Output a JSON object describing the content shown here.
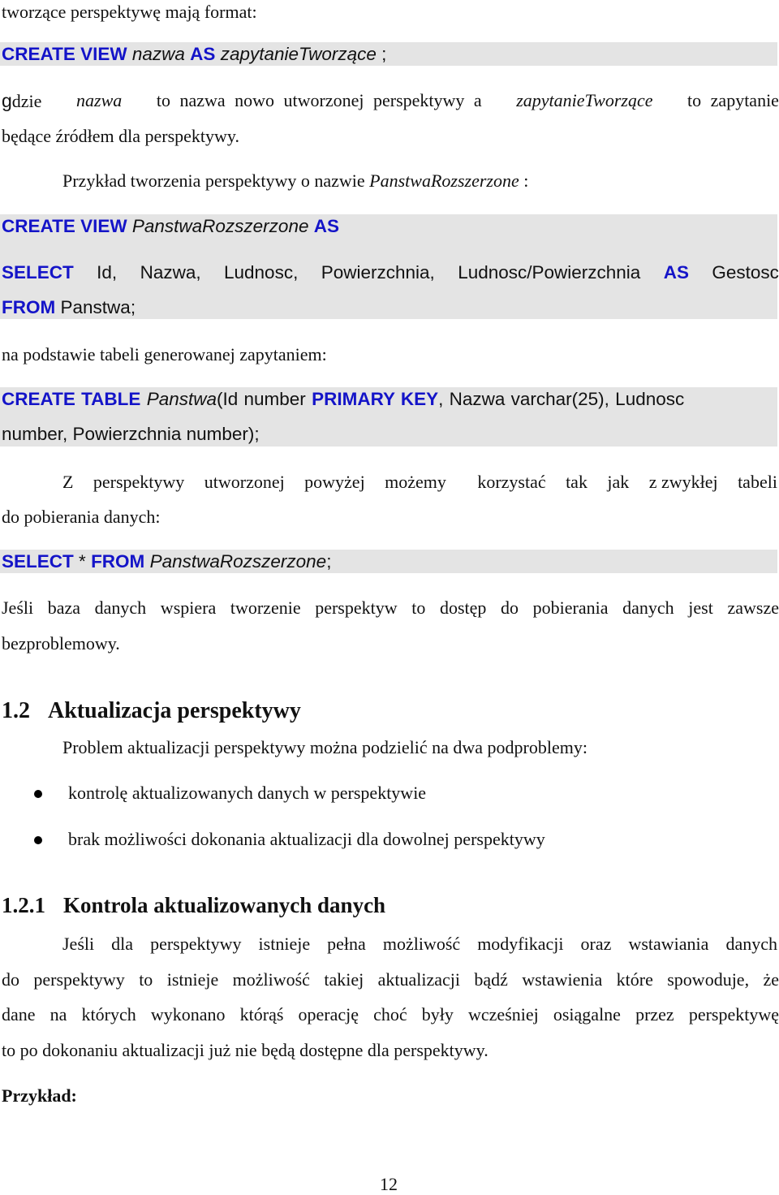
{
  "document": {
    "intro_line": "tworzące perspektywę mają format:",
    "syntax": {
      "kw1": "CREATE VIEW",
      "name": "nazwa",
      "kw2": "AS",
      "query": "zapytanieTworzące",
      "end": ";"
    },
    "where_para": {
      "lead_g": "g",
      "lead": "dzie",
      "name_it": "nazwa",
      "mid": "to nazwa nowo utworzonej perspektywy a",
      "query_it": "zapytanieTworzące",
      "tail": "to zapytanie",
      "line2": "będące źródłem dla perspektywy."
    },
    "example_intro": {
      "text": "Przykład tworzenia perspektywy o nazwie",
      "name_it": "PanstwaRozszerzone",
      "colon": ":"
    },
    "example_view": {
      "line1_kw": "CREATE VIEW",
      "line1_name": "PanstwaRozszerzone",
      "line1_kw2": "AS",
      "line2_kw": "SELECT",
      "line2_cols": [
        "Id,",
        "Nazwa,",
        "Ludnosc,",
        "Powierzchnia,",
        "Ludnosc/Powierzchnia"
      ],
      "line2_kw2": "AS",
      "line2_alias": "Gestosc",
      "line3_kw": "FROM",
      "line3_table": "Panstwa;"
    },
    "base_table_intro": "na podstawie tabeli generowanej zapytaniem:",
    "create_table": {
      "kw1": "CREATE TABLE",
      "name": "Panstwa",
      "part1": "(Id number",
      "kw2": "PRIMARY KEY",
      "part2": ", Nazwa varchar(25), Ludnosc",
      "line2": "number, Powierzchnia number);"
    },
    "usage_para": {
      "line1_words": [
        "Z",
        "perspektywy",
        "utworzonej",
        "powyżej",
        "możemy",
        "korzystać",
        "tak",
        "jak",
        "z zwykłej",
        "tabeli"
      ],
      "line2": "do pobierania danych:"
    },
    "select_example": {
      "kw1": "SELECT",
      "star": "*",
      "kw2": "FROM",
      "name": "PanstwaRozszerzone",
      "end": ";"
    },
    "support_para": {
      "line1": "Jeśli baza danych wspiera tworzenie perspektyw to dostęp do pobierania danych jest zawsze",
      "line2": "bezproblemowy."
    },
    "section_1_2": {
      "number": "1.2",
      "title": "Aktualizacja perspektywy",
      "intro": "Problem aktualizacji perspektywy można podzielić na dwa podproblemy:",
      "bullets": [
        "kontrolę aktualizowanych danych w perspektywie",
        "brak możliwości dokonania aktualizacji dla dowolnej perspektywy"
      ]
    },
    "section_1_2_1": {
      "number": "1.2.1",
      "title": "Kontrola aktualizowanych danych",
      "lines": [
        "Jeśli dla perspektywy istnieje pełna możliwość modyfikacji oraz wstawiania danych",
        "do perspektywy to istnieje możliwość takiej aktualizacji bądź wstawienia które spowoduje, że",
        "dane na których wykonano którąś operację choć były wcześniej osiągalne przez perspektywę",
        "to po dokonaniu aktualizacji już nie będą dostępne dla perspektywy."
      ]
    },
    "example_label": "Przykład:",
    "page_number": "12"
  },
  "colors": {
    "keyword": "#1414c8",
    "code_background": "#e4e4e4",
    "text": "#111111"
  }
}
